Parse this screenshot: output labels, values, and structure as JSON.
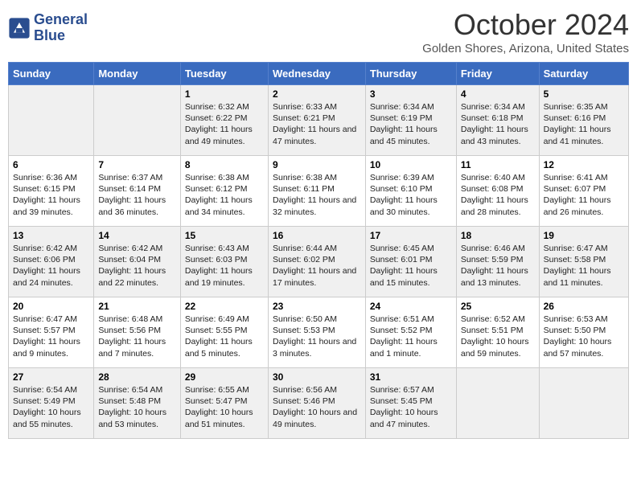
{
  "header": {
    "logo_line1": "General",
    "logo_line2": "Blue",
    "month": "October 2024",
    "location": "Golden Shores, Arizona, United States"
  },
  "days_of_week": [
    "Sunday",
    "Monday",
    "Tuesday",
    "Wednesday",
    "Thursday",
    "Friday",
    "Saturday"
  ],
  "weeks": [
    [
      {
        "day": "",
        "info": ""
      },
      {
        "day": "",
        "info": ""
      },
      {
        "day": "1",
        "info": "Sunrise: 6:32 AM\nSunset: 6:22 PM\nDaylight: 11 hours and 49 minutes."
      },
      {
        "day": "2",
        "info": "Sunrise: 6:33 AM\nSunset: 6:21 PM\nDaylight: 11 hours and 47 minutes."
      },
      {
        "day": "3",
        "info": "Sunrise: 6:34 AM\nSunset: 6:19 PM\nDaylight: 11 hours and 45 minutes."
      },
      {
        "day": "4",
        "info": "Sunrise: 6:34 AM\nSunset: 6:18 PM\nDaylight: 11 hours and 43 minutes."
      },
      {
        "day": "5",
        "info": "Sunrise: 6:35 AM\nSunset: 6:16 PM\nDaylight: 11 hours and 41 minutes."
      }
    ],
    [
      {
        "day": "6",
        "info": "Sunrise: 6:36 AM\nSunset: 6:15 PM\nDaylight: 11 hours and 39 minutes."
      },
      {
        "day": "7",
        "info": "Sunrise: 6:37 AM\nSunset: 6:14 PM\nDaylight: 11 hours and 36 minutes."
      },
      {
        "day": "8",
        "info": "Sunrise: 6:38 AM\nSunset: 6:12 PM\nDaylight: 11 hours and 34 minutes."
      },
      {
        "day": "9",
        "info": "Sunrise: 6:38 AM\nSunset: 6:11 PM\nDaylight: 11 hours and 32 minutes."
      },
      {
        "day": "10",
        "info": "Sunrise: 6:39 AM\nSunset: 6:10 PM\nDaylight: 11 hours and 30 minutes."
      },
      {
        "day": "11",
        "info": "Sunrise: 6:40 AM\nSunset: 6:08 PM\nDaylight: 11 hours and 28 minutes."
      },
      {
        "day": "12",
        "info": "Sunrise: 6:41 AM\nSunset: 6:07 PM\nDaylight: 11 hours and 26 minutes."
      }
    ],
    [
      {
        "day": "13",
        "info": "Sunrise: 6:42 AM\nSunset: 6:06 PM\nDaylight: 11 hours and 24 minutes."
      },
      {
        "day": "14",
        "info": "Sunrise: 6:42 AM\nSunset: 6:04 PM\nDaylight: 11 hours and 22 minutes."
      },
      {
        "day": "15",
        "info": "Sunrise: 6:43 AM\nSunset: 6:03 PM\nDaylight: 11 hours and 19 minutes."
      },
      {
        "day": "16",
        "info": "Sunrise: 6:44 AM\nSunset: 6:02 PM\nDaylight: 11 hours and 17 minutes."
      },
      {
        "day": "17",
        "info": "Sunrise: 6:45 AM\nSunset: 6:01 PM\nDaylight: 11 hours and 15 minutes."
      },
      {
        "day": "18",
        "info": "Sunrise: 6:46 AM\nSunset: 5:59 PM\nDaylight: 11 hours and 13 minutes."
      },
      {
        "day": "19",
        "info": "Sunrise: 6:47 AM\nSunset: 5:58 PM\nDaylight: 11 hours and 11 minutes."
      }
    ],
    [
      {
        "day": "20",
        "info": "Sunrise: 6:47 AM\nSunset: 5:57 PM\nDaylight: 11 hours and 9 minutes."
      },
      {
        "day": "21",
        "info": "Sunrise: 6:48 AM\nSunset: 5:56 PM\nDaylight: 11 hours and 7 minutes."
      },
      {
        "day": "22",
        "info": "Sunrise: 6:49 AM\nSunset: 5:55 PM\nDaylight: 11 hours and 5 minutes."
      },
      {
        "day": "23",
        "info": "Sunrise: 6:50 AM\nSunset: 5:53 PM\nDaylight: 11 hours and 3 minutes."
      },
      {
        "day": "24",
        "info": "Sunrise: 6:51 AM\nSunset: 5:52 PM\nDaylight: 11 hours and 1 minute."
      },
      {
        "day": "25",
        "info": "Sunrise: 6:52 AM\nSunset: 5:51 PM\nDaylight: 10 hours and 59 minutes."
      },
      {
        "day": "26",
        "info": "Sunrise: 6:53 AM\nSunset: 5:50 PM\nDaylight: 10 hours and 57 minutes."
      }
    ],
    [
      {
        "day": "27",
        "info": "Sunrise: 6:54 AM\nSunset: 5:49 PM\nDaylight: 10 hours and 55 minutes."
      },
      {
        "day": "28",
        "info": "Sunrise: 6:54 AM\nSunset: 5:48 PM\nDaylight: 10 hours and 53 minutes."
      },
      {
        "day": "29",
        "info": "Sunrise: 6:55 AM\nSunset: 5:47 PM\nDaylight: 10 hours and 51 minutes."
      },
      {
        "day": "30",
        "info": "Sunrise: 6:56 AM\nSunset: 5:46 PM\nDaylight: 10 hours and 49 minutes."
      },
      {
        "day": "31",
        "info": "Sunrise: 6:57 AM\nSunset: 5:45 PM\nDaylight: 10 hours and 47 minutes."
      },
      {
        "day": "",
        "info": ""
      },
      {
        "day": "",
        "info": ""
      }
    ]
  ]
}
